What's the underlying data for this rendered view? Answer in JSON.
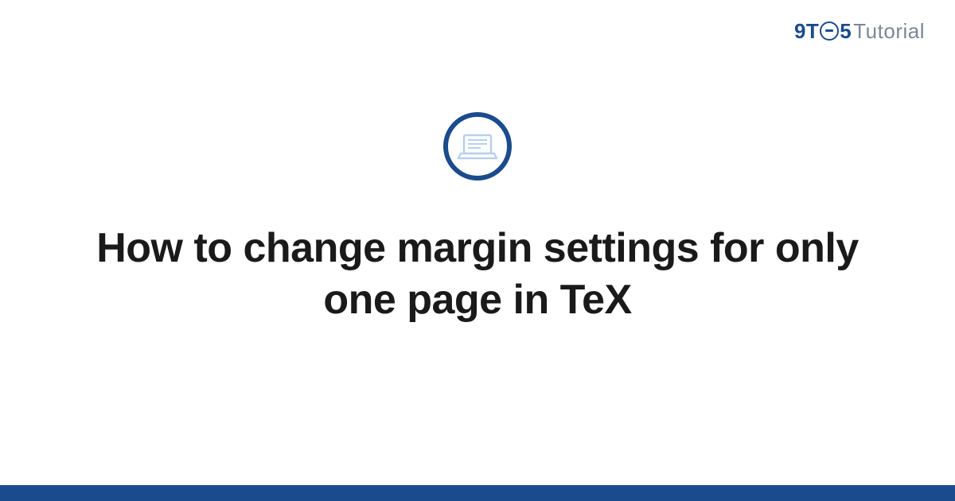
{
  "logo": {
    "prefix": "9T",
    "after_circle": "5",
    "suffix": "Tutorial"
  },
  "article": {
    "title": "How to change margin settings for only one page in TeX"
  },
  "colors": {
    "brand": "#1a4b8c",
    "muted": "#7a8796",
    "icon_light": "#b8d0ed"
  }
}
